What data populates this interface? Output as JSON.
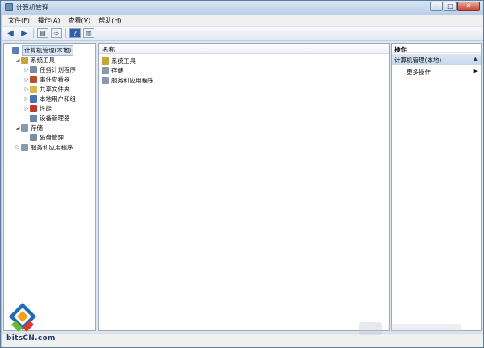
{
  "window": {
    "title": "计算机管理"
  },
  "menu": [
    "文件(F)",
    "操作(A)",
    "查看(V)",
    "帮助(H)"
  ],
  "tree": [
    {
      "label": "计算机管理(本地)",
      "level": 0,
      "arrow": "",
      "icon": "computer-management-icon",
      "color": "#5a7fb0",
      "selected": true
    },
    {
      "label": "系统工具",
      "level": 1,
      "arrow": "◢",
      "icon": "system-tools-icon",
      "color": "#c9a43a"
    },
    {
      "label": "任务计划程序",
      "level": 2,
      "arrow": "▷",
      "icon": "task-scheduler-icon",
      "color": "#7c8c9e"
    },
    {
      "label": "事件查看器",
      "level": 2,
      "arrow": "▷",
      "icon": "event-viewer-icon",
      "color": "#b8502f"
    },
    {
      "label": "共享文件夹",
      "level": 2,
      "arrow": "▷",
      "icon": "shared-folders-icon",
      "color": "#d8b44a"
    },
    {
      "label": "本地用户和组",
      "level": 2,
      "arrow": "▷",
      "icon": "local-users-icon",
      "color": "#4a72b2"
    },
    {
      "label": "性能",
      "level": 2,
      "arrow": "▷",
      "icon": "performance-icon",
      "color": "#c03a2b"
    },
    {
      "label": "设备管理器",
      "level": 2,
      "arrow": "",
      "icon": "device-manager-icon",
      "color": "#6b86a8"
    },
    {
      "label": "存储",
      "level": 1,
      "arrow": "◢",
      "icon": "storage-icon",
      "color": "#8a9aae"
    },
    {
      "label": "磁盘管理",
      "level": 2,
      "arrow": "",
      "icon": "disk-management-icon",
      "color": "#7a8ca0"
    },
    {
      "label": "服务和应用程序",
      "level": 1,
      "arrow": "▷",
      "icon": "services-apps-icon",
      "color": "#8a9aae"
    }
  ],
  "list": {
    "column_name": "名称",
    "items": [
      {
        "label": "系统工具",
        "icon": "system-tools-icon",
        "color": "#c9a43a"
      },
      {
        "label": "存储",
        "icon": "storage-icon",
        "color": "#8a9aae"
      },
      {
        "label": "服务和应用程序",
        "icon": "services-apps-icon",
        "color": "#8a9aae"
      }
    ]
  },
  "actions": {
    "header": "操作",
    "section": "计算机管理(本地)",
    "more": "更多操作"
  },
  "watermark": {
    "text": "bitsCN.com"
  }
}
